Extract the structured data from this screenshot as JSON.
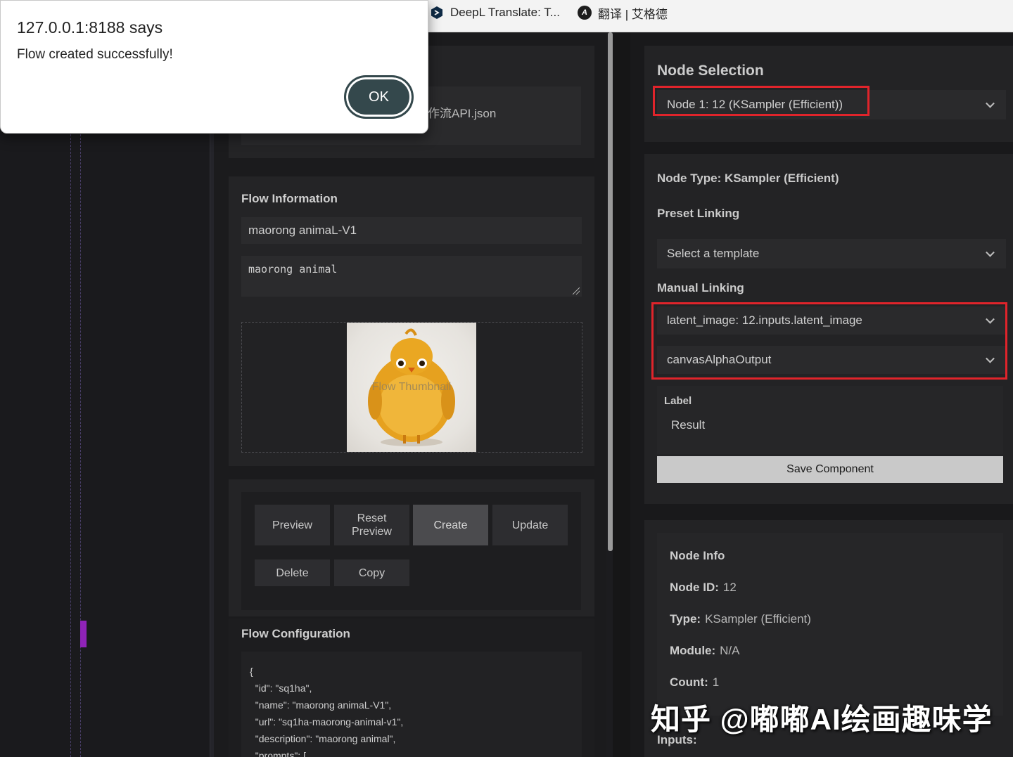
{
  "browser": {
    "tabs": [
      {
        "label": "DeepL Translate: T...",
        "icon": "deepl-icon"
      },
      {
        "label": "翻译 | 艾格德",
        "icon": "iciba-icon"
      }
    ]
  },
  "dialog": {
    "origin": "127.0.0.1:8188 says",
    "message": "Flow created successfully!",
    "ok_label": "OK"
  },
  "upload": {
    "file_name": "作流API.json"
  },
  "flow_info": {
    "title": "Flow Information",
    "name_value": "maorong animaL-V1",
    "description_value": "maorong animal",
    "thumbnail_label": "Flow Thumbnail"
  },
  "actions": {
    "preview": "Preview",
    "reset_preview": "Reset Preview",
    "create": "Create",
    "update": "Update",
    "delete": "Delete",
    "copy": "Copy"
  },
  "config": {
    "title": "Flow Configuration",
    "json_text": "{\n  \"id\": \"sq1ha\",\n  \"name\": \"maorong animaL-V1\",\n  \"url\": \"sq1ha-maorong-animal-v1\",\n  \"description\": \"maorong animal\",\n  \"prompts\": ["
  },
  "node_selection": {
    "title": "Node Selection",
    "selected": "Node 1: 12 (KSampler (Efficient))"
  },
  "node_config": {
    "node_type": "Node Type: KSampler (Efficient)",
    "preset_title": "Preset Linking",
    "preset_placeholder": "Select a template",
    "manual_title": "Manual Linking",
    "input_link": "latent_image: 12.inputs.latent_image",
    "output_link": "canvasAlphaOutput",
    "label_title": "Label",
    "label_value": "Result",
    "save_label": "Save Component"
  },
  "node_info": {
    "title": "Node Info",
    "node_id_key": "Node ID:",
    "node_id_value": "12",
    "type_key": "Type:",
    "type_value": "KSampler (Efficient)",
    "module_key": "Module:",
    "module_value": "N/A",
    "count_key": "Count:",
    "count_value": "1",
    "inputs_title": "Inputs:"
  },
  "watermark": "知乎 @嘟嘟AI绘画趣味学",
  "colors": {
    "highlight_red": "#e0242b",
    "ok_button": "#34484c",
    "marker_purple": "#8f23b7"
  }
}
